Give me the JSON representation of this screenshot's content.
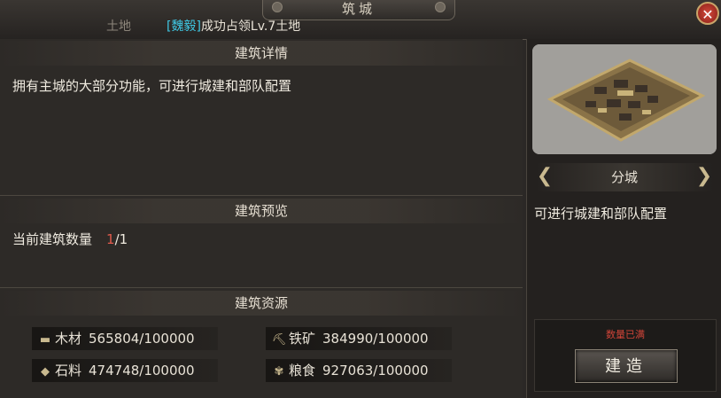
{
  "header": {
    "title": "筑城",
    "notice_fade": "土地",
    "notice_tag": "[魏毅]",
    "notice_text": "成功占领Lv.7土地",
    "close_glyph": "✕"
  },
  "details": {
    "heading": "建筑详情",
    "description": "拥有主城的大部分功能，可进行城建和部队配置"
  },
  "preview": {
    "heading": "建筑预览",
    "count_label": "当前建筑数量",
    "count_current": "1",
    "count_total": "/1"
  },
  "resources": {
    "heading": "建筑资源",
    "items": [
      {
        "name": "木材",
        "value": "565804/100000",
        "icon": "wood-icon"
      },
      {
        "name": "铁矿",
        "value": "384990/100000",
        "icon": "iron-icon"
      },
      {
        "name": "石料",
        "value": "474748/100000",
        "icon": "stone-icon"
      },
      {
        "name": "粮食",
        "value": "927063/100000",
        "icon": "grain-icon"
      }
    ]
  },
  "side": {
    "building_name": "分城",
    "description": "可进行城建和部队配置",
    "full_notice": "数量已满",
    "build_label": "建造",
    "prev_glyph": "❮",
    "next_glyph": "❯"
  },
  "colors": {
    "tag": "#3fc8e4",
    "count_highlight": "#e05a4c",
    "full_notice": "#d04438"
  }
}
